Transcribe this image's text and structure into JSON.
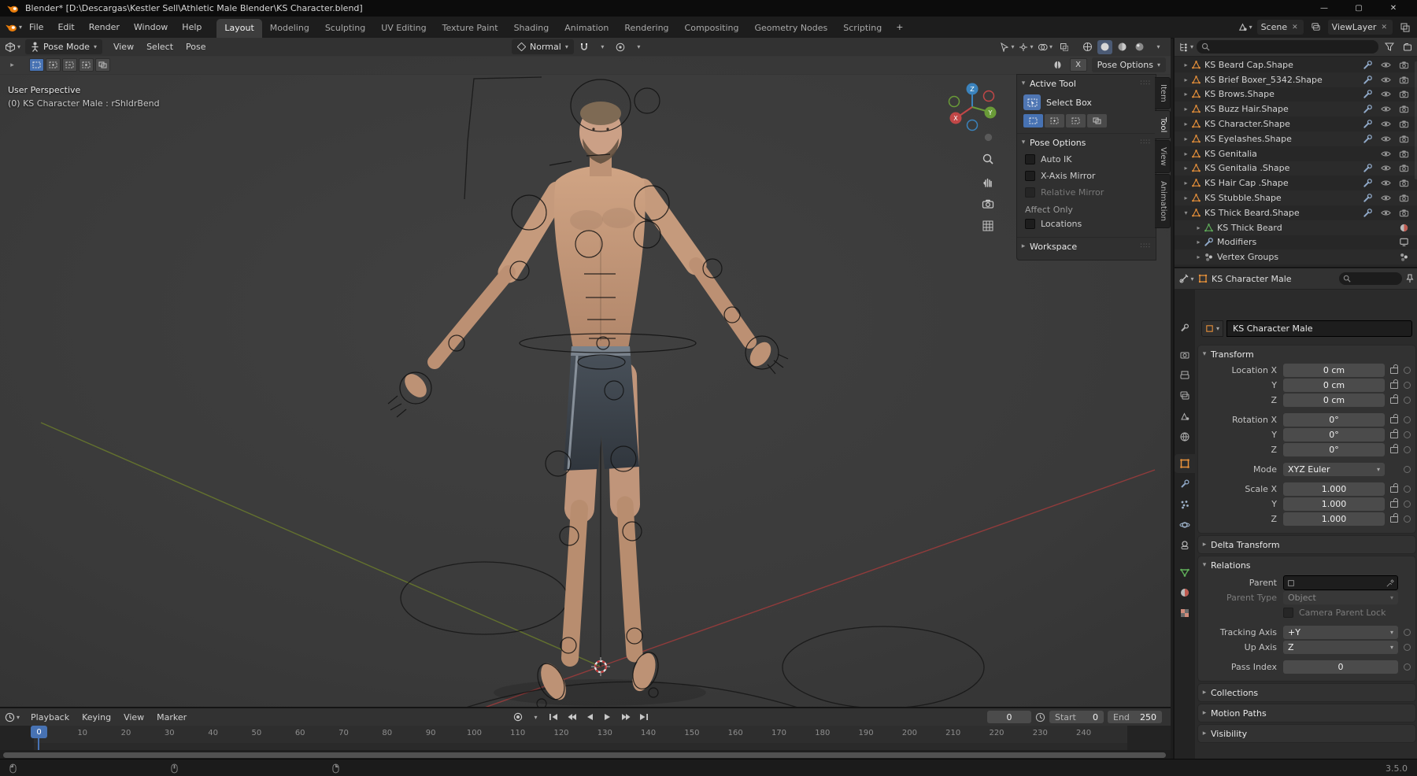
{
  "titlebar": {
    "title": "Blender* [D:\\Descargas\\Kestler Sell\\Athletic Male Blender\\KS Character.blend]"
  },
  "topbar": {
    "menus": [
      "File",
      "Edit",
      "Render",
      "Window",
      "Help"
    ],
    "workspaces": [
      "Layout",
      "Modeling",
      "Sculpting",
      "UV Editing",
      "Texture Paint",
      "Shading",
      "Animation",
      "Rendering",
      "Compositing",
      "Geometry Nodes",
      "Scripting"
    ],
    "active_workspace": "Layout",
    "add_workspace_label": "+",
    "scene_name": "Scene",
    "viewlayer_name": "ViewLayer"
  },
  "viewport": {
    "mode_label": "Pose Mode",
    "menus": [
      "View",
      "Select",
      "Pose"
    ],
    "orientation_label": "Normal",
    "mirror_x_label": "X",
    "pose_options_button": "Pose Options",
    "overlay_line1": "User Perspective",
    "overlay_line2": "(0) KS Character Male : rShldrBend",
    "gizmo": {
      "x": "X",
      "y": "Y",
      "z": "Z"
    }
  },
  "sidebar": {
    "tabs": [
      "Item",
      "Tool",
      "View",
      "Animation"
    ],
    "active_tab": "Tool",
    "active_tool_title": "Active Tool",
    "tool_name": "Select Box",
    "pose_options_title": "Pose Options",
    "pose_toggles": [
      {
        "label": "Auto IK",
        "disabled": false
      },
      {
        "label": "X-Axis Mirror",
        "disabled": false
      },
      {
        "label": "Relative Mirror",
        "disabled": true
      }
    ],
    "affect_only_label": "Affect Only",
    "locations_label": "Locations",
    "workspace_title": "Workspace"
  },
  "outliner": {
    "items": [
      {
        "name": "KS Beard Cap.Shape",
        "level": 0,
        "arrow": "right",
        "icon": "mesh",
        "wrench": true,
        "eye": true,
        "camera": true,
        "right": ""
      },
      {
        "name": "KS Brief Boxer_5342.Shape",
        "level": 0,
        "arrow": "right",
        "icon": "mesh",
        "wrench": true,
        "eye": true,
        "camera": true,
        "right": ""
      },
      {
        "name": "KS Brows.Shape",
        "level": 0,
        "arrow": "right",
        "icon": "mesh",
        "wrench": true,
        "eye": true,
        "camera": true,
        "right": ""
      },
      {
        "name": "KS Buzz Hair.Shape",
        "level": 0,
        "arrow": "right",
        "icon": "mesh",
        "wrench": true,
        "eye": true,
        "camera": true,
        "right": ""
      },
      {
        "name": "KS Character.Shape",
        "level": 0,
        "arrow": "right",
        "icon": "mesh",
        "wrench": true,
        "eye": true,
        "camera": true,
        "right": ""
      },
      {
        "name": "KS Eyelashes.Shape",
        "level": 0,
        "arrow": "right",
        "icon": "mesh",
        "wrench": true,
        "eye": true,
        "camera": true,
        "right": ""
      },
      {
        "name": "KS Genitalia",
        "level": 0,
        "arrow": "right",
        "icon": "mesh",
        "wrench": false,
        "eye": true,
        "camera": true,
        "right": ""
      },
      {
        "name": "KS Genitalia .Shape",
        "level": 0,
        "arrow": "right",
        "icon": "mesh",
        "wrench": true,
        "eye": true,
        "camera": true,
        "right": ""
      },
      {
        "name": "KS Hair Cap .Shape",
        "level": 0,
        "arrow": "right",
        "icon": "mesh",
        "wrench": true,
        "eye": true,
        "camera": true,
        "right": ""
      },
      {
        "name": "KS Stubble.Shape",
        "level": 0,
        "arrow": "right",
        "icon": "mesh",
        "wrench": true,
        "eye": true,
        "camera": true,
        "right": ""
      },
      {
        "name": "KS Thick Beard.Shape",
        "level": 0,
        "arrow": "down",
        "icon": "mesh",
        "wrench": true,
        "eye": true,
        "camera": true,
        "right": ""
      },
      {
        "name": "KS Thick Beard",
        "level": 1,
        "arrow": "right",
        "icon": "meshdata",
        "wrench": false,
        "eye": false,
        "camera": false,
        "right": "material"
      },
      {
        "name": "Modifiers",
        "level": 1,
        "arrow": "right",
        "icon": "wrench",
        "wrench": false,
        "eye": false,
        "camera": false,
        "right": "screen"
      },
      {
        "name": "Vertex Groups",
        "level": 1,
        "arrow": "right",
        "icon": "group",
        "wrench": false,
        "eye": false,
        "camera": false,
        "right": "group"
      }
    ]
  },
  "properties": {
    "breadcrumb_object": "KS Character Male",
    "id_name": "KS Character Male",
    "transform_title": "Transform",
    "transform_rows": [
      {
        "label": "Location X",
        "value": "0 cm",
        "lock": true,
        "dropdown": false,
        "gap": false
      },
      {
        "label": "Y",
        "value": "0 cm",
        "lock": true,
        "dropdown": false,
        "gap": false
      },
      {
        "label": "Z",
        "value": "0 cm",
        "lock": true,
        "dropdown": false,
        "gap": false
      },
      {
        "label": "Rotation X",
        "value": "0°",
        "lock": true,
        "dropdown": false,
        "gap": true
      },
      {
        "label": "Y",
        "value": "0°",
        "lock": true,
        "dropdown": false,
        "gap": false
      },
      {
        "label": "Z",
        "value": "0°",
        "lock": true,
        "dropdown": false,
        "gap": false
      },
      {
        "label": "Mode",
        "value": "XYZ Euler",
        "lock": false,
        "dropdown": true,
        "gap": true
      },
      {
        "label": "Scale X",
        "value": "1.000",
        "lock": true,
        "dropdown": false,
        "gap": true
      },
      {
        "label": "Y",
        "value": "1.000",
        "lock": true,
        "dropdown": false,
        "gap": false
      },
      {
        "label": "Z",
        "value": "1.000",
        "lock": true,
        "dropdown": false,
        "gap": false
      }
    ],
    "delta_transform_title": "Delta Transform",
    "relations_title": "Relations",
    "parent_label": "Parent",
    "parent_type_label": "Parent Type",
    "parent_type_value": "Object",
    "camera_parent_lock_label": "Camera Parent Lock",
    "tracking_axis_label": "Tracking Axis",
    "tracking_axis_value": "+Y",
    "up_axis_label": "Up Axis",
    "up_axis_value": "Z",
    "pass_index_label": "Pass Index",
    "pass_index_value": "0",
    "collapsed_panels": [
      "Collections",
      "Motion Paths",
      "Visibility"
    ]
  },
  "timeline": {
    "menus": [
      "Playback",
      "Keying",
      "View",
      "Marker"
    ],
    "current_frame": "0",
    "start_label": "Start",
    "start_value": "0",
    "end_label": "End",
    "end_value": "250",
    "ruler_labels": [
      "0",
      "10",
      "20",
      "30",
      "40",
      "50",
      "60",
      "70",
      "80",
      "90",
      "100",
      "110",
      "120",
      "130",
      "140",
      "150",
      "160",
      "170",
      "180",
      "190",
      "200",
      "210",
      "220",
      "230",
      "240"
    ],
    "playhead_label": "0"
  },
  "statusbar": {
    "version": "3.5.0"
  }
}
